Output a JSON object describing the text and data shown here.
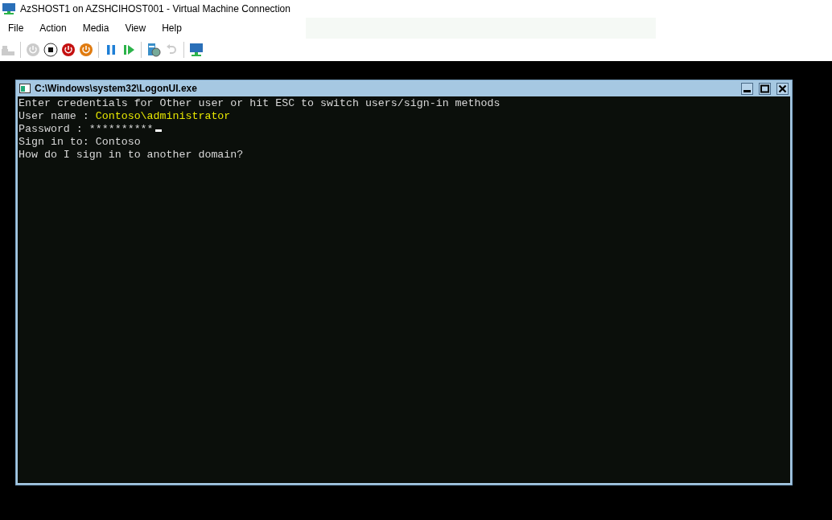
{
  "window": {
    "title": "AzSHOST1 on AZSHCIHOST001 - Virtual Machine Connection"
  },
  "menu": [
    "File",
    "Action",
    "Media",
    "View",
    "Help"
  ],
  "toolbar": [
    {
      "kind": "ctrl-alt-del",
      "disabled": true
    },
    {
      "kind": "separator",
      "disabled": false
    },
    {
      "kind": "start",
      "disabled": true
    },
    {
      "kind": "turn-off",
      "disabled": false
    },
    {
      "kind": "shut-down",
      "disabled": false
    },
    {
      "kind": "save",
      "disabled": false
    },
    {
      "kind": "separator",
      "disabled": false
    },
    {
      "kind": "pause",
      "disabled": false
    },
    {
      "kind": "reset",
      "disabled": false
    },
    {
      "kind": "separator",
      "disabled": false
    },
    {
      "kind": "checkpoint",
      "disabled": false
    },
    {
      "kind": "revert",
      "disabled": true
    },
    {
      "kind": "separator",
      "disabled": false
    },
    {
      "kind": "enhanced",
      "disabled": false
    }
  ],
  "console": {
    "title": "C:\\Windows\\system32\\LogonUI.exe",
    "lines": [
      {
        "kind": "text",
        "text": "Enter credentials for Other user or hit ESC to switch users/sign-in methods"
      },
      {
        "kind": "field",
        "label": "User name : ",
        "value": "Contoso\\administrator",
        "highlighted": true,
        "cursor": false
      },
      {
        "kind": "field",
        "label": "Password : ",
        "value": "**********",
        "highlighted": false,
        "cursor": true
      },
      {
        "kind": "text",
        "text": "Sign in to: Contoso"
      },
      {
        "kind": "text",
        "text": "How do I sign in to another domain?"
      }
    ]
  }
}
